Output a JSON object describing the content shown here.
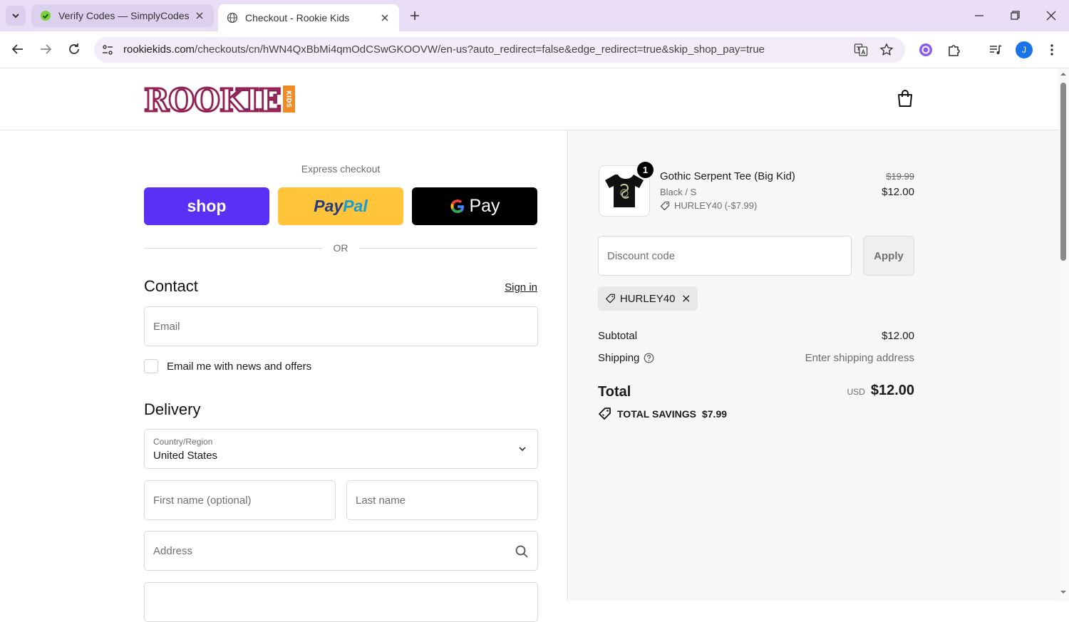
{
  "browser": {
    "tabs": [
      {
        "title": "Verify Codes — SimplyCodes"
      },
      {
        "title": "Checkout - Rookie Kids"
      }
    ],
    "url_host": "rookiekids.com",
    "url_rest": "/checkouts/cn/hWN4QxBbMi4qmOdCSwGKOOVW/en-us?auto_redirect=false&edge_redirect=true&skip_shop_pay=true",
    "profile_initial": "J"
  },
  "store": {
    "logo_text": "ROOKIE",
    "logo_sub": "KIDS"
  },
  "checkout": {
    "express_label": "Express checkout",
    "shop_label": "shop",
    "paypal_part1": "Pay",
    "paypal_part2": "Pal",
    "gpay_label": "Pay",
    "or_label": "OR",
    "contact_heading": "Contact",
    "sign_in": "Sign in",
    "email_placeholder": "Email",
    "news_label": "Email me with news and offers",
    "delivery_heading": "Delivery",
    "country_label": "Country/Region",
    "country_value": "United States",
    "first_name_placeholder": "First name (optional)",
    "last_name_placeholder": "Last name",
    "address_placeholder": "Address"
  },
  "summary": {
    "item": {
      "quantity": "1",
      "name": "Gothic Serpent Tee (Big Kid)",
      "variant": "Black / S",
      "discount": "HURLEY40 (-$7.99)",
      "original_price": "$19.99",
      "price": "$12.00"
    },
    "discount_placeholder": "Discount code",
    "apply_label": "Apply",
    "applied_code": "HURLEY40",
    "subtotal_label": "Subtotal",
    "subtotal_value": "$12.00",
    "shipping_label": "Shipping",
    "shipping_value": "Enter shipping address",
    "total_label": "Total",
    "currency": "USD",
    "total_value": "$12.00",
    "savings_label": "TOTAL SAVINGS",
    "savings_value": "$7.99"
  },
  "colors": {
    "shop_pay": "#5a31f4",
    "paypal": "#ffc439",
    "gpay": "#000000",
    "logo_red": "#c8242f",
    "logo_purple": "#4b2a8c",
    "logo_orange": "#f08a24"
  }
}
